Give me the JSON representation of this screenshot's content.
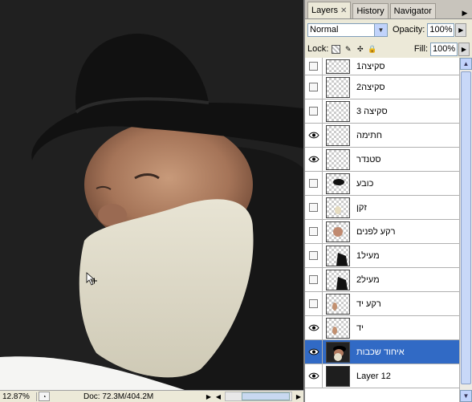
{
  "panel": {
    "tabs": [
      {
        "label": "Layers",
        "active": true,
        "closable": true
      },
      {
        "label": "History",
        "active": false
      },
      {
        "label": "Navigator",
        "active": false
      }
    ],
    "blend_mode": "Normal",
    "opacity_label": "Opacity:",
    "opacity_value": "100%",
    "lock_label": "Lock:",
    "fill_label": "Fill:",
    "fill_value": "100%",
    "layers": [
      {
        "name": "סקיצה1",
        "visible": false,
        "thumb": "transparent"
      },
      {
        "name": "סקיצה2",
        "visible": false,
        "thumb": "transparent"
      },
      {
        "name": "סקיצה 3",
        "visible": false,
        "thumb": "transparent"
      },
      {
        "name": "חתימה",
        "visible": true,
        "thumb": "transparent"
      },
      {
        "name": "סטנדר",
        "visible": true,
        "thumb": "transparent"
      },
      {
        "name": "כובע",
        "visible": false,
        "thumb": "hat"
      },
      {
        "name": "זקן",
        "visible": false,
        "thumb": "beard"
      },
      {
        "name": "רקע לפנים",
        "visible": false,
        "thumb": "face"
      },
      {
        "name": "מעיל1",
        "visible": false,
        "thumb": "coat"
      },
      {
        "name": "מעיל2",
        "visible": false,
        "thumb": "coat"
      },
      {
        "name": "רקע יד",
        "visible": false,
        "thumb": "hand"
      },
      {
        "name": "יד",
        "visible": true,
        "thumb": "hand"
      },
      {
        "name": "איחוד שכבות",
        "visible": true,
        "thumb": "portrait",
        "selected": true
      },
      {
        "name": "Layer 12",
        "visible": true,
        "thumb": "black"
      }
    ]
  },
  "status": {
    "zoom": "12.87%",
    "doc": "Doc: 72.3M/404.2M"
  },
  "colors": {
    "selection": "#316ac5",
    "canvas_bg": "#202020"
  }
}
